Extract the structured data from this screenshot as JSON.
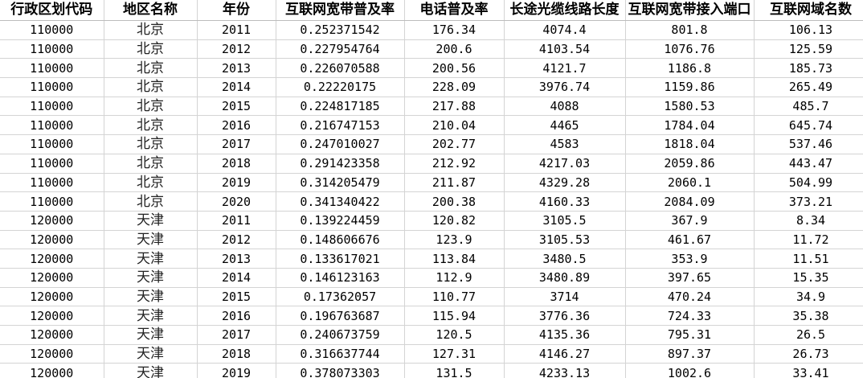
{
  "columns": [
    "行政区划代码",
    "地区名称",
    "年份",
    "互联网宽带普及率",
    "电话普及率",
    "长途光缆线路长度",
    "互联网宽带接入端口",
    "互联网域名数"
  ],
  "rows": [
    [
      "110000",
      "北京",
      "2011",
      "0.252371542",
      "176.34",
      "4074.4",
      "801.8",
      "106.13"
    ],
    [
      "110000",
      "北京",
      "2012",
      "0.227954764",
      "200.6",
      "4103.54",
      "1076.76",
      "125.59"
    ],
    [
      "110000",
      "北京",
      "2013",
      "0.226070588",
      "200.56",
      "4121.7",
      "1186.8",
      "185.73"
    ],
    [
      "110000",
      "北京",
      "2014",
      "0.22220175",
      "228.09",
      "3976.74",
      "1159.86",
      "265.49"
    ],
    [
      "110000",
      "北京",
      "2015",
      "0.224817185",
      "217.88",
      "4088",
      "1580.53",
      "485.7"
    ],
    [
      "110000",
      "北京",
      "2016",
      "0.216747153",
      "210.04",
      "4465",
      "1784.04",
      "645.74"
    ],
    [
      "110000",
      "北京",
      "2017",
      "0.247010027",
      "202.77",
      "4583",
      "1818.04",
      "537.46"
    ],
    [
      "110000",
      "北京",
      "2018",
      "0.291423358",
      "212.92",
      "4217.03",
      "2059.86",
      "443.47"
    ],
    [
      "110000",
      "北京",
      "2019",
      "0.314205479",
      "211.87",
      "4329.28",
      "2060.1",
      "504.99"
    ],
    [
      "110000",
      "北京",
      "2020",
      "0.341340422",
      "200.38",
      "4160.33",
      "2084.09",
      "373.21"
    ],
    [
      "120000",
      "天津",
      "2011",
      "0.139224459",
      "120.82",
      "3105.5",
      "367.9",
      "8.34"
    ],
    [
      "120000",
      "天津",
      "2012",
      "0.148606676",
      "123.9",
      "3105.53",
      "461.67",
      "11.72"
    ],
    [
      "120000",
      "天津",
      "2013",
      "0.133617021",
      "113.84",
      "3480.5",
      "353.9",
      "11.51"
    ],
    [
      "120000",
      "天津",
      "2014",
      "0.146123163",
      "112.9",
      "3480.89",
      "397.65",
      "15.35"
    ],
    [
      "120000",
      "天津",
      "2015",
      "0.17362057",
      "110.77",
      "3714",
      "470.24",
      "34.9"
    ],
    [
      "120000",
      "天津",
      "2016",
      "0.196763687",
      "115.94",
      "3776.36",
      "724.33",
      "35.38"
    ],
    [
      "120000",
      "天津",
      "2017",
      "0.240673759",
      "120.5",
      "4135.36",
      "795.31",
      "26.5"
    ],
    [
      "120000",
      "天津",
      "2018",
      "0.316637744",
      "127.31",
      "4146.27",
      "897.37",
      "26.73"
    ],
    [
      "120000",
      "天津",
      "2019",
      "0.378073303",
      "131.5",
      "4233.13",
      "1002.6",
      "33.41"
    ]
  ]
}
